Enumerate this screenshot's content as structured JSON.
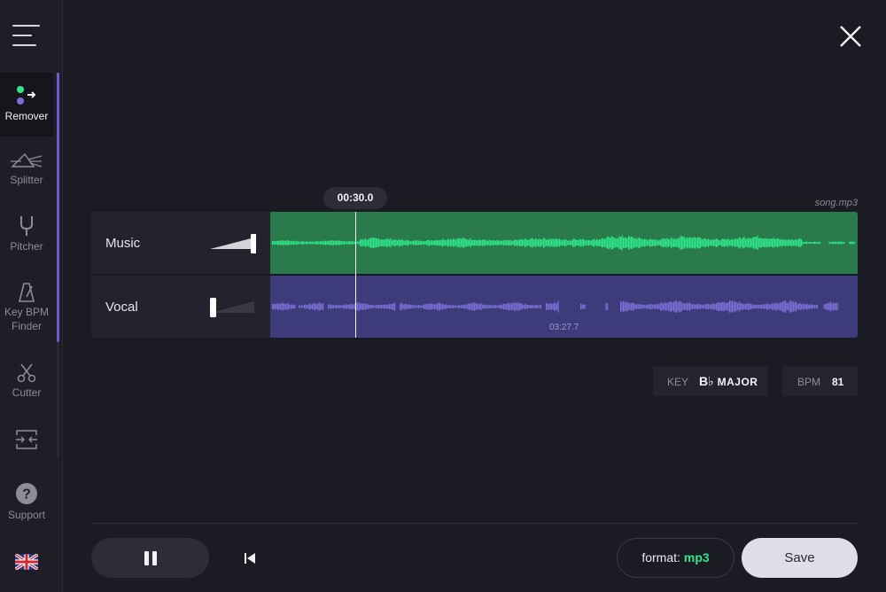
{
  "sidebar": {
    "tools": [
      {
        "label": "Remover",
        "active": true
      },
      {
        "label": "Splitter",
        "active": false
      },
      {
        "label": "Pitcher",
        "active": false
      },
      {
        "label": "Key BPM Finder",
        "active": false
      },
      {
        "label": "Cutter",
        "active": false
      },
      {
        "label": "",
        "active": false
      }
    ],
    "support_label": "Support",
    "language": "English (UK flag)"
  },
  "player": {
    "current_time": "00:30.0",
    "file_name": "song.mp3",
    "duration": "03:27.7",
    "playhead_fraction": 0.145,
    "tracks": [
      {
        "name": "Music",
        "volume_fraction": 1.0
      },
      {
        "name": "Vocal",
        "volume_fraction": 0.0
      }
    ]
  },
  "analysis": {
    "key_label": "KEY",
    "key_note": "B♭",
    "key_mode": "MAJOR",
    "bpm_label": "BPM",
    "bpm_value": "81"
  },
  "controls": {
    "format_label": "format:",
    "format_value": "mp3",
    "save_label": "Save"
  },
  "colors": {
    "music_bg": "#2a7a4b",
    "music_wave": "#2ee88a",
    "vocal_bg": "#3e3b7a",
    "vocal_wave": "#7b6fd6",
    "accent": "#6b5fc7"
  }
}
